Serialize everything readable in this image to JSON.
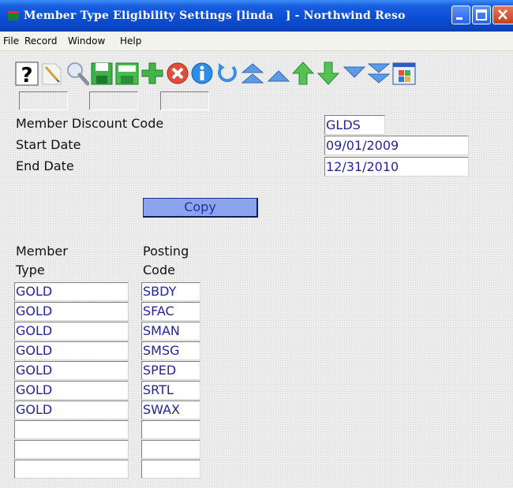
{
  "window": {
    "title": "Member Type Eligibility Settings [linda   ] - Northwind Reso"
  },
  "menu": [
    "File",
    "Record",
    "Window",
    "Help"
  ],
  "toolbar": {
    "buttons": [
      "help",
      "edit",
      "search",
      "save",
      "add",
      "delete",
      "info",
      "undo",
      "first",
      "previous",
      "up",
      "down",
      "next",
      "last",
      "windows"
    ]
  },
  "form": {
    "discount_code": {
      "label": "Member Discount Code",
      "value": "GLDS"
    },
    "start_date": {
      "label": "Start Date",
      "value": "09/01/2009"
    },
    "end_date": {
      "label": "End Date",
      "value": "12/31/2010"
    },
    "copy_label": "Copy"
  },
  "grid": {
    "col1_header": [
      "Member",
      "Type"
    ],
    "col2_header": [
      "Posting",
      "Code"
    ],
    "rows": [
      {
        "member_type": "GOLD",
        "posting_code": "SBDY"
      },
      {
        "member_type": "GOLD",
        "posting_code": "SFAC"
      },
      {
        "member_type": "GOLD",
        "posting_code": "SMAN"
      },
      {
        "member_type": "GOLD",
        "posting_code": "SMSG"
      },
      {
        "member_type": "GOLD",
        "posting_code": "SPED"
      },
      {
        "member_type": "GOLD",
        "posting_code": "SRTL"
      },
      {
        "member_type": "GOLD",
        "posting_code": "SWAX"
      },
      {
        "member_type": "",
        "posting_code": ""
      },
      {
        "member_type": "",
        "posting_code": ""
      },
      {
        "member_type": "",
        "posting_code": ""
      }
    ]
  }
}
